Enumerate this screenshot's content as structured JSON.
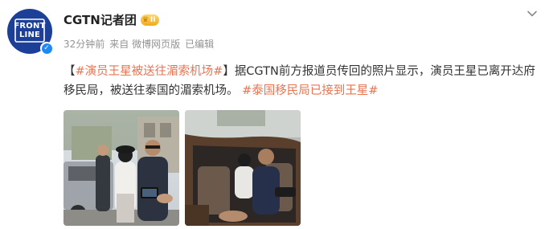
{
  "account": {
    "name": "CGTN记者团",
    "level_badge": "II",
    "avatar_text_line1": "FRONT",
    "avatar_text_line2": "LINE"
  },
  "meta": {
    "time": "32分钟前",
    "source": "来自 微博网页版",
    "edited": "已编辑"
  },
  "post": {
    "bracket_open": "【",
    "topic1": "#演员王星被送往湄索机场#",
    "bracket_close": "】",
    "body": "据CGTN前方报道员传回的照片显示，演员王星已离开达府移民局，被送往泰国的湄索机场。",
    "topic2": "#泰国移民局已接到王星#"
  },
  "icons": {
    "more": "chevron-down-icon",
    "verified": "verified-badge-icon"
  },
  "colors": {
    "topic": "#eb7350",
    "avatar_bg": "#1c3f98",
    "verified": "#1e88f5"
  }
}
